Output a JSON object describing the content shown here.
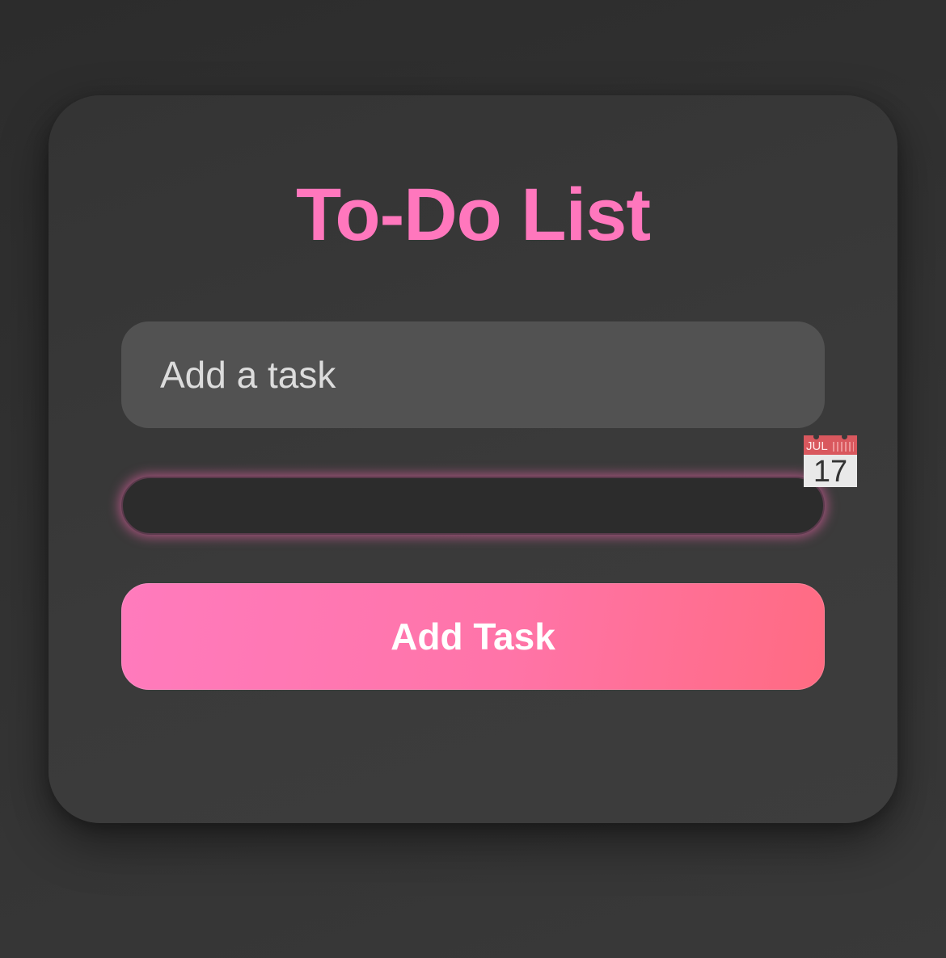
{
  "todo": {
    "title": "To-Do List",
    "task_input": {
      "placeholder": "Add a task",
      "value": ""
    },
    "date_input": {
      "value": "",
      "calendar_icon": {
        "icon": "calendar-icon",
        "month": "JUL",
        "day": "17"
      }
    },
    "add_button_label": "Add Task"
  },
  "colors": {
    "accent": "#ff77bd",
    "button_gradient_start": "#ff7bbd",
    "button_gradient_end": "#ff6b82",
    "card_background": "#383838",
    "input_background": "#525252",
    "date_input_background": "#2c2c2c"
  }
}
